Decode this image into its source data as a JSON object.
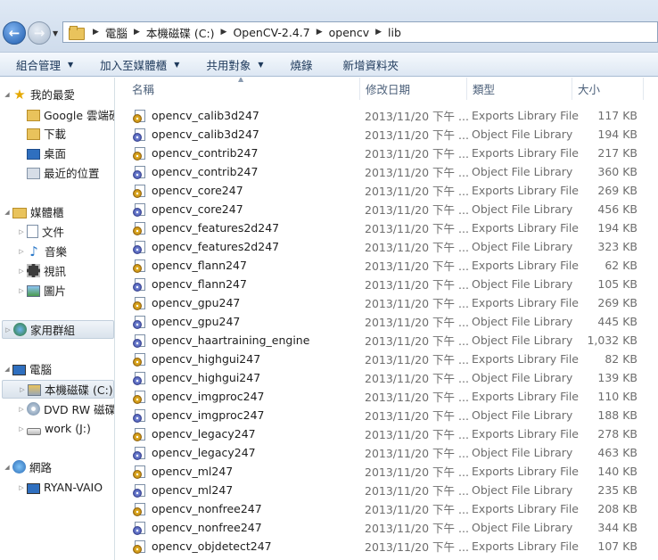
{
  "address": {
    "crumbs": [
      "電腦",
      "本機磁碟 (C:)",
      "OpenCV-2.4.7",
      "opencv",
      "lib"
    ]
  },
  "toolbar": {
    "items": [
      {
        "label": "組合管理",
        "dropdown": true
      },
      {
        "label": "加入至媒體櫃",
        "dropdown": true
      },
      {
        "label": "共用對象",
        "dropdown": true
      },
      {
        "label": "燒錄",
        "dropdown": false
      },
      {
        "label": "新增資料夾",
        "dropdown": false
      }
    ]
  },
  "nav": {
    "favorites": {
      "label": "我的最愛",
      "children": [
        "Google 雲端硬碟",
        "下載",
        "桌面",
        "最近的位置"
      ]
    },
    "libraries": {
      "label": "媒體櫃",
      "children": [
        "文件",
        "音樂",
        "視訊",
        "圖片"
      ]
    },
    "homegroup": {
      "label": "家用群組"
    },
    "computer": {
      "label": "電腦",
      "children": [
        "本機磁碟 (C:)",
        "DVD RW 磁碟機",
        "work (J:)"
      ]
    },
    "network": {
      "label": "網路",
      "children": [
        "RYAN-VAIO"
      ]
    }
  },
  "columns": {
    "name": "名稱",
    "date": "修改日期",
    "type": "類型",
    "size": "大小"
  },
  "files": [
    {
      "name": "opencv_calib3d247",
      "date": "2013/11/20 下午 ...",
      "type": "Exports Library File",
      "size": "117 KB",
      "kind": "exp"
    },
    {
      "name": "opencv_calib3d247",
      "date": "2013/11/20 下午 ...",
      "type": "Object File Library",
      "size": "194 KB",
      "kind": "obj"
    },
    {
      "name": "opencv_contrib247",
      "date": "2013/11/20 下午 ...",
      "type": "Exports Library File",
      "size": "217 KB",
      "kind": "exp"
    },
    {
      "name": "opencv_contrib247",
      "date": "2013/11/20 下午 ...",
      "type": "Object File Library",
      "size": "360 KB",
      "kind": "obj"
    },
    {
      "name": "opencv_core247",
      "date": "2013/11/20 下午 ...",
      "type": "Exports Library File",
      "size": "269 KB",
      "kind": "exp"
    },
    {
      "name": "opencv_core247",
      "date": "2013/11/20 下午 ...",
      "type": "Object File Library",
      "size": "456 KB",
      "kind": "obj"
    },
    {
      "name": "opencv_features2d247",
      "date": "2013/11/20 下午 ...",
      "type": "Exports Library File",
      "size": "194 KB",
      "kind": "exp"
    },
    {
      "name": "opencv_features2d247",
      "date": "2013/11/20 下午 ...",
      "type": "Object File Library",
      "size": "323 KB",
      "kind": "obj"
    },
    {
      "name": "opencv_flann247",
      "date": "2013/11/20 下午 ...",
      "type": "Exports Library File",
      "size": "62 KB",
      "kind": "exp"
    },
    {
      "name": "opencv_flann247",
      "date": "2013/11/20 下午 ...",
      "type": "Object File Library",
      "size": "105 KB",
      "kind": "obj"
    },
    {
      "name": "opencv_gpu247",
      "date": "2013/11/20 下午 ...",
      "type": "Exports Library File",
      "size": "269 KB",
      "kind": "exp"
    },
    {
      "name": "opencv_gpu247",
      "date": "2013/11/20 下午 ...",
      "type": "Object File Library",
      "size": "445 KB",
      "kind": "obj"
    },
    {
      "name": "opencv_haartraining_engine",
      "date": "2013/11/20 下午 ...",
      "type": "Object File Library",
      "size": "1,032 KB",
      "kind": "obj"
    },
    {
      "name": "opencv_highgui247",
      "date": "2013/11/20 下午 ...",
      "type": "Exports Library File",
      "size": "82 KB",
      "kind": "exp"
    },
    {
      "name": "opencv_highgui247",
      "date": "2013/11/20 下午 ...",
      "type": "Object File Library",
      "size": "139 KB",
      "kind": "obj"
    },
    {
      "name": "opencv_imgproc247",
      "date": "2013/11/20 下午 ...",
      "type": "Exports Library File",
      "size": "110 KB",
      "kind": "exp"
    },
    {
      "name": "opencv_imgproc247",
      "date": "2013/11/20 下午 ...",
      "type": "Object File Library",
      "size": "188 KB",
      "kind": "obj"
    },
    {
      "name": "opencv_legacy247",
      "date": "2013/11/20 下午 ...",
      "type": "Exports Library File",
      "size": "278 KB",
      "kind": "exp"
    },
    {
      "name": "opencv_legacy247",
      "date": "2013/11/20 下午 ...",
      "type": "Object File Library",
      "size": "463 KB",
      "kind": "obj"
    },
    {
      "name": "opencv_ml247",
      "date": "2013/11/20 下午 ...",
      "type": "Exports Library File",
      "size": "140 KB",
      "kind": "exp"
    },
    {
      "name": "opencv_ml247",
      "date": "2013/11/20 下午 ...",
      "type": "Object File Library",
      "size": "235 KB",
      "kind": "obj"
    },
    {
      "name": "opencv_nonfree247",
      "date": "2013/11/20 下午 ...",
      "type": "Exports Library File",
      "size": "208 KB",
      "kind": "exp"
    },
    {
      "name": "opencv_nonfree247",
      "date": "2013/11/20 下午 ...",
      "type": "Object File Library",
      "size": "344 KB",
      "kind": "obj"
    },
    {
      "name": "opencv_objdetect247",
      "date": "2013/11/20 下午 ...",
      "type": "Exports Library File",
      "size": "107 KB",
      "kind": "exp"
    }
  ]
}
